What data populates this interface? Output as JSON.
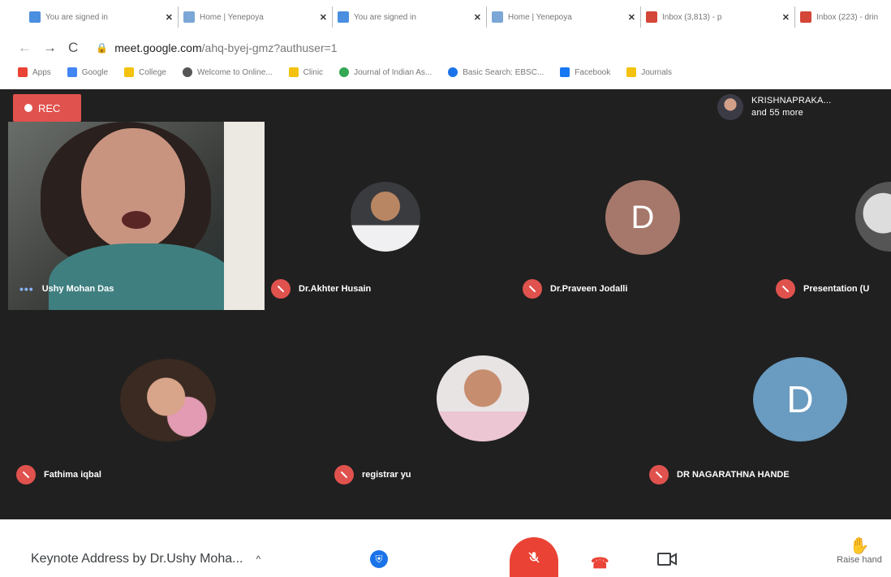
{
  "browser": {
    "tabs": [
      {
        "title": "You are signed in",
        "favicon_color": "#4a8fe0"
      },
      {
        "title": "Home | Yenepoya",
        "favicon_color": "#7aa7d6"
      },
      {
        "title": "You are signed in",
        "favicon_color": "#4a8fe0"
      },
      {
        "title": "Home | Yenepoya",
        "favicon_color": "#7aa7d6"
      },
      {
        "title": "Inbox (3,813) - p",
        "favicon_color": "#d44638"
      },
      {
        "title": "Inbox (223) - drin",
        "favicon_color": "#d44638"
      }
    ],
    "close_glyph": "✕",
    "nav": {
      "back": "←",
      "forward": "→",
      "reload": "C"
    },
    "url_host": "meet.google.com",
    "url_path": "/ahq-byej-gmz?authuser=1",
    "bookmarks": [
      {
        "label": "Apps",
        "color": "#ea4335"
      },
      {
        "label": "Google",
        "color": "#4285f4"
      },
      {
        "label": "College",
        "color": "#f4c20d"
      },
      {
        "label": "Welcome to Online...",
        "color": "#555555"
      },
      {
        "label": "Clinic",
        "color": "#f4c20d"
      },
      {
        "label": "Journal of Indian As...",
        "color": "#34a853"
      },
      {
        "label": "Basic Search: EBSC...",
        "color": "#1a73e8"
      },
      {
        "label": "Facebook",
        "color": "#1877f2"
      },
      {
        "label": "Journals",
        "color": "#f4c20d"
      }
    ]
  },
  "meeting": {
    "rec_label": "REC",
    "others_line1": "KRISHNAPRAKA...",
    "others_line2": "and 55 more",
    "speaker": {
      "name": "Ushy Mohan Das",
      "indicator": "•••"
    },
    "participants": [
      {
        "name": "Dr.Akhter Husain",
        "type": "photo"
      },
      {
        "name": "Dr.Praveen Jodalli",
        "type": "letter",
        "letter": "D",
        "color": "#a6786b"
      },
      {
        "name": "Presentation (U",
        "type": "photo"
      },
      {
        "name": "Fathima iqbal",
        "type": "photo"
      },
      {
        "name": "registrar yu",
        "type": "photo"
      },
      {
        "name": "DR NAGARATHNA HANDE",
        "type": "letter",
        "letter": "D",
        "color": "#6a9bc0"
      }
    ]
  },
  "controls": {
    "meeting_title": "Keynote Address by Dr.Ushy Moha...",
    "chevron": "^",
    "raise_hand_label": "Raise hand",
    "end_call_glyph": "☎"
  }
}
